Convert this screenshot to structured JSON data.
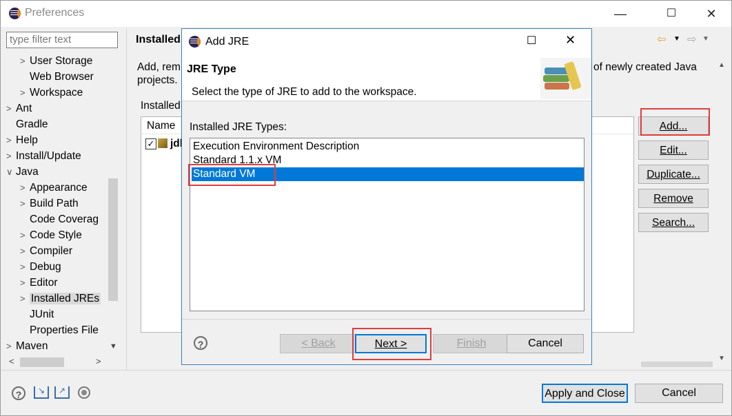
{
  "window": {
    "title": "Preferences"
  },
  "filter": {
    "placeholder": "type filter text"
  },
  "tree": {
    "items": [
      {
        "label": "User Storage",
        "indent": 1,
        "chevron": ">"
      },
      {
        "label": "Web Browser",
        "indent": 1,
        "chevron": ""
      },
      {
        "label": "Workspace",
        "indent": 1,
        "chevron": ">"
      },
      {
        "label": "Ant",
        "indent": 0,
        "chevron": ">"
      },
      {
        "label": "Gradle",
        "indent": 0,
        "chevron": ""
      },
      {
        "label": "Help",
        "indent": 0,
        "chevron": ">"
      },
      {
        "label": "Install/Update",
        "indent": 0,
        "chevron": ">"
      },
      {
        "label": "Java",
        "indent": 0,
        "chevron": "v"
      },
      {
        "label": "Appearance",
        "indent": 1,
        "chevron": ">"
      },
      {
        "label": "Build Path",
        "indent": 1,
        "chevron": ">"
      },
      {
        "label": "Code Coverag",
        "indent": 1,
        "chevron": ""
      },
      {
        "label": "Code Style",
        "indent": 1,
        "chevron": ">"
      },
      {
        "label": "Compiler",
        "indent": 1,
        "chevron": ">"
      },
      {
        "label": "Debug",
        "indent": 1,
        "chevron": ">"
      },
      {
        "label": "Editor",
        "indent": 1,
        "chevron": ">"
      },
      {
        "label": "Installed JREs",
        "indent": 1,
        "chevron": ">"
      },
      {
        "label": "JUnit",
        "indent": 1,
        "chevron": ""
      },
      {
        "label": "Properties File",
        "indent": 1,
        "chevron": ""
      },
      {
        "label": "Maven",
        "indent": 0,
        "chevron": ">"
      }
    ]
  },
  "right": {
    "title": "Installed",
    "desc_left": "Add, rem",
    "desc_right": "of newly created Java",
    "desc_line2": "projects.",
    "installed_label": "Installed",
    "table_col_name": "Name",
    "row_label": "jdl",
    "buttons": {
      "add": "Add...",
      "edit": "Edit...",
      "duplicate": "Duplicate...",
      "remove": "Remove",
      "search": "Search..."
    }
  },
  "bottom": {
    "apply_close": "Apply and Close",
    "cancel": "Cancel"
  },
  "dialog": {
    "title": "Add JRE",
    "header_title": "JRE Type",
    "header_desc": "Select the type of JRE to add to the workspace.",
    "list_label": "Installed JRE Types:",
    "types": [
      "Execution Environment Description",
      "Standard 1.1.x VM",
      "Standard VM"
    ],
    "selected_index": 2,
    "buttons": {
      "back": "< Back",
      "next": "Next >",
      "finish": "Finish",
      "cancel": "Cancel"
    }
  },
  "colors": {
    "selection": "#0078d7",
    "highlight_box": "#e03c3c",
    "dialog_border": "#3a7fc0"
  }
}
